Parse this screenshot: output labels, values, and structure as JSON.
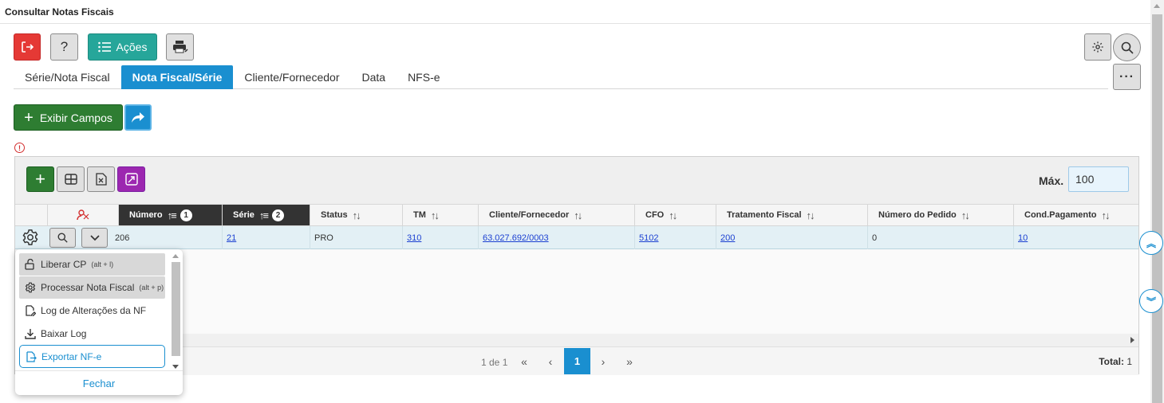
{
  "window": {
    "title": "Consultar Notas Fiscais"
  },
  "toolbar": {
    "acoes_label": "Ações",
    "help_label": "?",
    "more_label": "···"
  },
  "tabs": [
    {
      "label": "Série/Nota Fiscal"
    },
    {
      "label": "Nota Fiscal/Série",
      "active": true
    },
    {
      "label": "Cliente/Fornecedor"
    },
    {
      "label": "Data"
    },
    {
      "label": "NFS-e"
    }
  ],
  "actions": {
    "exibir_campos_label": "Exibir Campos"
  },
  "grid": {
    "max_label": "Máx.",
    "max_value": "100",
    "columns": [
      {
        "label": "Número",
        "sort_order": "1"
      },
      {
        "label": "Série",
        "sort_order": "2"
      },
      {
        "label": "Status"
      },
      {
        "label": "TM"
      },
      {
        "label": "Cliente/Fornecedor"
      },
      {
        "label": "CFO"
      },
      {
        "label": "Tratamento Fiscal"
      },
      {
        "label": "Número do Pedido"
      },
      {
        "label": "Cond.Pagamento"
      }
    ],
    "rows": [
      {
        "numero": "206",
        "serie": "21",
        "status": "PRO",
        "tm": "310",
        "cliente": "63.027.692/0003",
        "cfo": "5102",
        "tratamento": "200",
        "pedido": "0",
        "cond_pagamento": "10"
      }
    ],
    "pager": {
      "info": "1 de 1",
      "current_page": "1",
      "total_label": "Total:",
      "total_value": "1"
    }
  },
  "context_menu": {
    "items": [
      {
        "label": "Liberar CP",
        "shortcut": "(alt + l)",
        "icon": "unlock-icon"
      },
      {
        "label": "Processar Nota Fiscal",
        "shortcut": "(alt + p)",
        "icon": "gear-icon"
      },
      {
        "label": "Log de Alterações da NF",
        "icon": "file-edit-icon"
      },
      {
        "label": "Baixar Log",
        "icon": "download-icon"
      },
      {
        "label": "Exportar NF-e",
        "icon": "file-export-icon"
      }
    ],
    "close_label": "Fechar"
  },
  "colors": {
    "primary": "#1a8fd0",
    "success": "#2e7d32",
    "danger": "#e53935",
    "teal": "#26a69a",
    "purple": "#9c27b0"
  }
}
